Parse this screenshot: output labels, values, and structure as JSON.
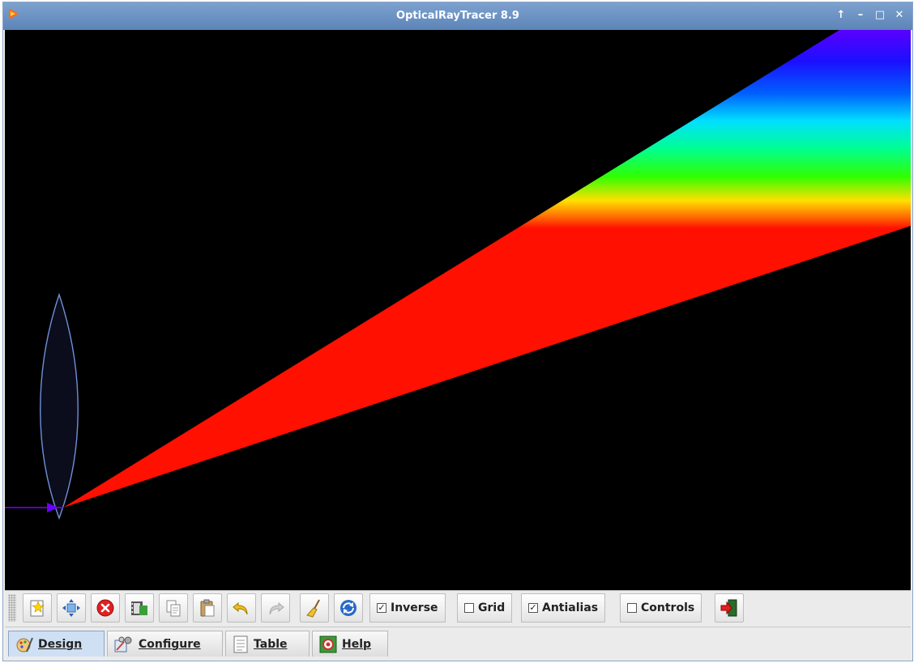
{
  "window": {
    "title": "OpticalRayTracer 8.9"
  },
  "toolbar": {
    "buttons": [
      {
        "icon": "new-icon"
      },
      {
        "icon": "move-icon"
      },
      {
        "icon": "delete-icon"
      },
      {
        "icon": "film-icon"
      },
      {
        "icon": "copy-icon"
      },
      {
        "icon": "paste-icon"
      },
      {
        "icon": "undo-icon"
      },
      {
        "icon": "redo-icon"
      },
      {
        "icon": "broom-icon"
      },
      {
        "icon": "refresh-icon"
      }
    ],
    "checkboxes": [
      {
        "label": "Inverse",
        "checked": true
      },
      {
        "label": "Grid",
        "checked": false
      },
      {
        "label": "Antialias",
        "checked": true
      },
      {
        "label": "Controls",
        "checked": false
      }
    ]
  },
  "tabs": [
    {
      "label": "Design",
      "active": true,
      "icon": "design-icon"
    },
    {
      "label": "Configure",
      "active": false,
      "icon": "configure-icon"
    },
    {
      "label": "Table",
      "active": false,
      "icon": "table-icon"
    },
    {
      "label": "Help",
      "active": false,
      "icon": "help-icon"
    }
  ],
  "colors": {
    "accent": "#6a8fc0",
    "canvas_bg": "#000000",
    "lens_outline": "#6f8fd8"
  }
}
